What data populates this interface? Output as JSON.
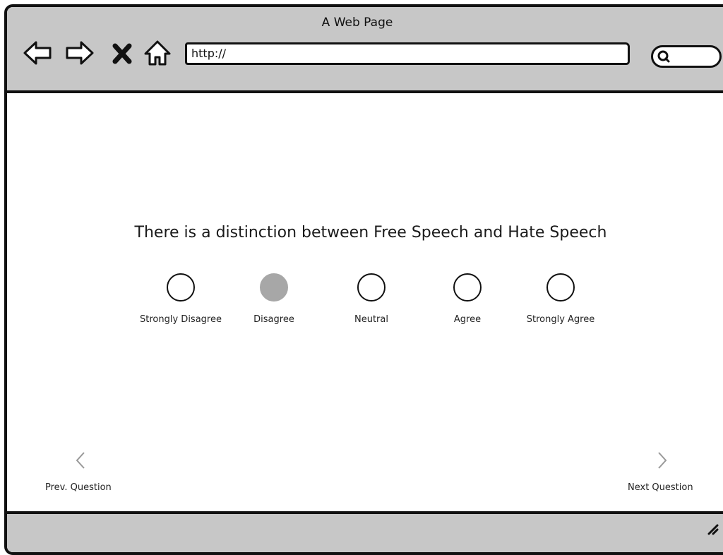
{
  "browser": {
    "title": "A Web Page",
    "url": "http://",
    "search_value": ""
  },
  "icons": {
    "back": "arrow-left-icon",
    "forward": "arrow-right-icon",
    "stop": "close-icon",
    "home": "home-icon",
    "search": "search-icon",
    "prev": "chevron-left-icon",
    "next": "chevron-right-icon",
    "resize": "resize-grip-icon"
  },
  "survey": {
    "question": "There is a distinction between Free Speech and Hate Speech",
    "options": [
      {
        "label": "Strongly Disagree",
        "selected": false
      },
      {
        "label": "Disagree",
        "selected": true
      },
      {
        "label": "Neutral",
        "selected": false
      },
      {
        "label": "Agree",
        "selected": false
      },
      {
        "label": "Strongly Agree",
        "selected": false
      }
    ]
  },
  "navigation": {
    "prev_label": "Prev. Question",
    "next_label": "Next Question"
  },
  "colors": {
    "chrome_gray": "#c7c7c7",
    "selected_fill": "#a7a7a7",
    "chevron_gray": "#999999"
  }
}
